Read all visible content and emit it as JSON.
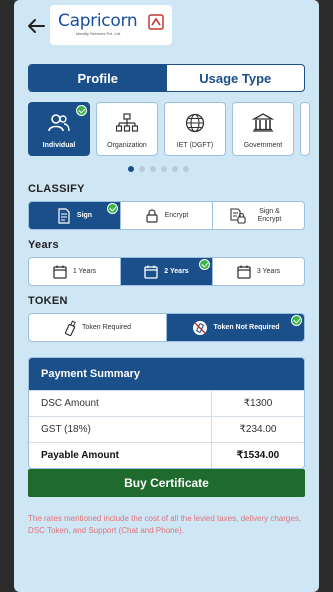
{
  "header": {
    "logo_text": "Capricorn",
    "logo_sub": "Identity Services Pvt. Ltd."
  },
  "tabs": [
    {
      "label": "Profile",
      "active": true
    },
    {
      "label": "Usage Type",
      "active": false
    }
  ],
  "profile_cards": [
    {
      "label": "Individual",
      "icon": "users-icon",
      "active": true
    },
    {
      "label": "Organization",
      "icon": "org-chart-icon",
      "active": false
    },
    {
      "label": "IET (DGFT)",
      "icon": "globe-icon",
      "active": false
    },
    {
      "label": "Government",
      "icon": "government-building-icon",
      "active": false
    }
  ],
  "carousel": {
    "total": 6,
    "active_index": 0
  },
  "classify": {
    "title": "CLASSIFY",
    "options": [
      {
        "label": "Sign",
        "icon": "document-sign-icon",
        "active": true
      },
      {
        "label": "Encrypt",
        "icon": "lock-icon",
        "active": false
      },
      {
        "label": "Sign & Encrypt",
        "icon": "sign-encrypt-icon",
        "active": false
      }
    ]
  },
  "years": {
    "title": "Years",
    "options": [
      {
        "label": "1 Years",
        "icon": "calendar-icon",
        "active": false
      },
      {
        "label": "2 Years",
        "icon": "calendar-icon",
        "active": true
      },
      {
        "label": "3 Years",
        "icon": "calendar-icon",
        "active": false
      }
    ]
  },
  "token": {
    "title": "TOKEN",
    "options": [
      {
        "label": "Token Required",
        "icon": "usb-token-icon",
        "active": false
      },
      {
        "label": "Token Not Required",
        "icon": "no-token-icon",
        "active": true
      }
    ]
  },
  "summary": {
    "title": "Payment Summary",
    "rows": [
      {
        "label": "DSC Amount",
        "value": "₹1300",
        "bold": false
      },
      {
        "label": "GST (18%)",
        "value": "₹234.00",
        "bold": false
      },
      {
        "label": "Payable Amount",
        "value": "₹1534.00",
        "bold": true
      }
    ]
  },
  "buy_label": "Buy Certificate",
  "note": "The rates mentioned include the cost of all the levied taxes, delivery charges, DSC Token, and Support (Chat and Phone).",
  "colors": {
    "primary": "#1b4f8a",
    "success": "#3cb44b",
    "buy": "#1f6b2d",
    "note": "#e0737a",
    "background": "#cfe6f5"
  }
}
